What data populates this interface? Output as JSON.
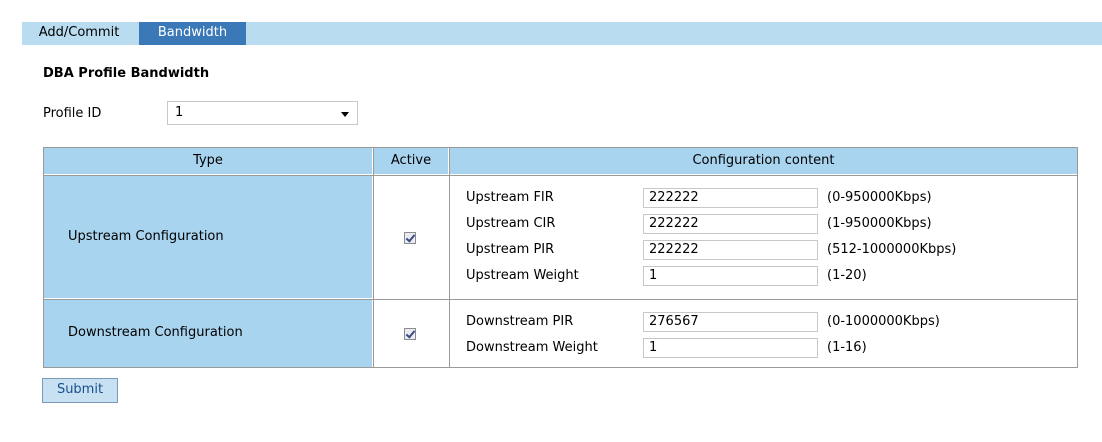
{
  "tabs": [
    {
      "label": "Add/Commit",
      "active": false
    },
    {
      "label": "Bandwidth",
      "active": true
    }
  ],
  "section_title": "DBA Profile Bandwidth",
  "profile": {
    "label": "Profile ID",
    "value": "1"
  },
  "table": {
    "headers": {
      "type": "Type",
      "active": "Active",
      "config": "Configuration content"
    },
    "upstream": {
      "type_label": "Upstream Configuration",
      "active": true,
      "fields": [
        {
          "label": "Upstream FIR",
          "value": "222222",
          "range": "(0-950000Kbps)"
        },
        {
          "label": "Upstream CIR",
          "value": "222222",
          "range": "(1-950000Kbps)"
        },
        {
          "label": "Upstream PIR",
          "value": "222222",
          "range": "(512-1000000Kbps)"
        },
        {
          "label": "Upstream Weight",
          "value": "1",
          "range": "(1-20)"
        }
      ]
    },
    "downstream": {
      "type_label": "Downstream Configuration",
      "active": true,
      "fields": [
        {
          "label": "Downstream PIR",
          "value": "276567",
          "range": "(0-1000000Kbps)"
        },
        {
          "label": "Downstream Weight",
          "value": "1",
          "range": "(1-16)"
        }
      ]
    }
  },
  "submit_label": "Submit",
  "colors": {
    "tabbar": "#b9dcf0",
    "active_tab": "#3a78b8",
    "header_cell": "#a9d4ef"
  }
}
